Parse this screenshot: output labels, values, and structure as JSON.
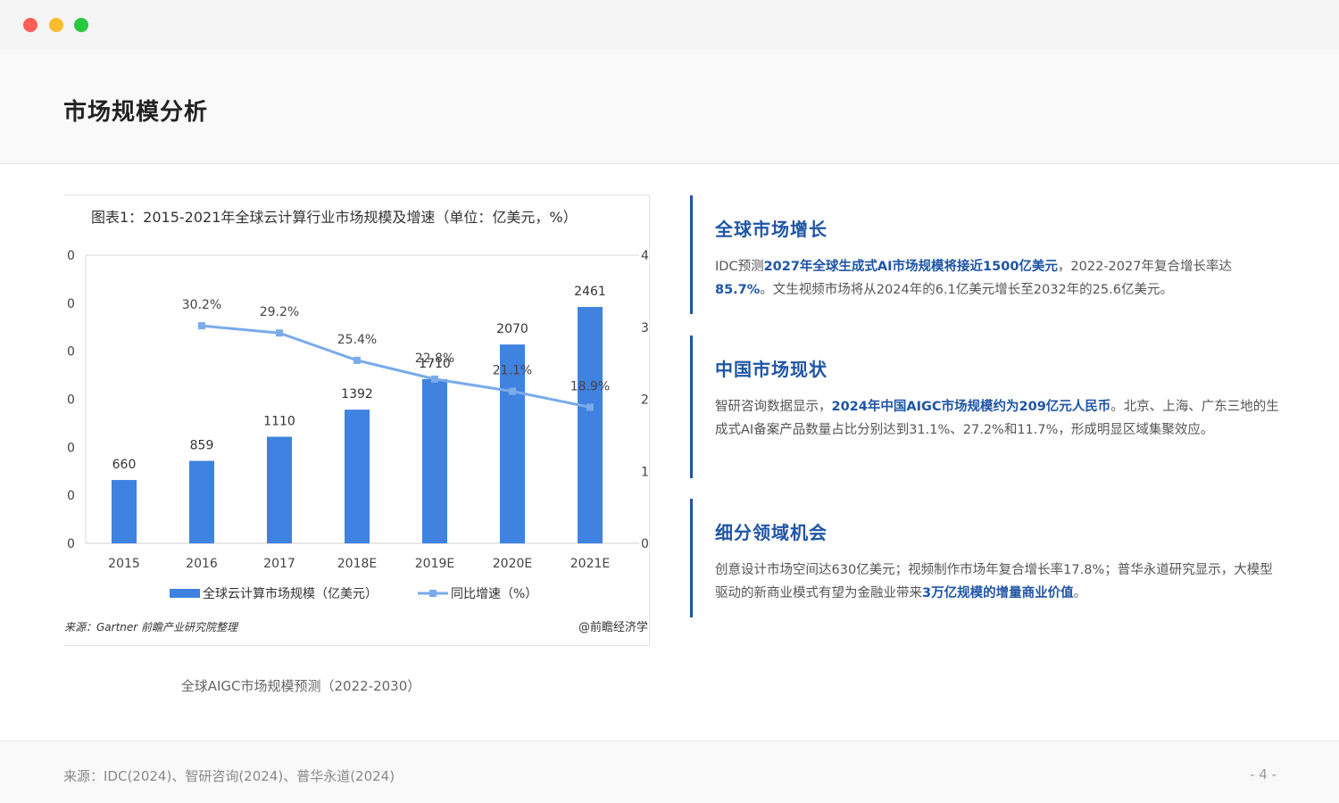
{
  "window": {
    "title": "市场规模分析"
  },
  "chart_data": {
    "type": "bar",
    "title": "图表1：2015-2021年全球云计算行业市场规模及增速（单位：亿美元，%）",
    "categories": [
      "2015",
      "2016",
      "2017",
      "2018E",
      "2019E",
      "2020E",
      "2021E"
    ],
    "series": [
      {
        "name": "全球云计算市场规模（亿美元）",
        "type": "bar",
        "values": [
          660,
          859,
          1110,
          1392,
          1710,
          2070,
          2461
        ],
        "color": "#3f82e0"
      },
      {
        "name": "同比增速（%）",
        "type": "line",
        "values": [
          null,
          30.2,
          29.2,
          25.4,
          22.8,
          21.1,
          18.9
        ],
        "color": "#7aabea"
      }
    ],
    "y_left_tick_labels": [
      "0",
      "0",
      "0",
      "0",
      "0",
      "0",
      "0"
    ],
    "y_right_tick_labels": [
      "0",
      "1",
      "2",
      "3",
      "4"
    ],
    "ylim_left": [
      0,
      3000
    ],
    "ylim_right": [
      0,
      40
    ],
    "grid": false,
    "legend": "bottom",
    "source_left": "来源：Gartner 前瞻产业研究院整理",
    "source_right": "@前瞻经济学"
  },
  "chart_caption": "全球AIGC市场规模预测（2022-2030）",
  "sections": [
    {
      "title": "全球市场增长",
      "parts": [
        {
          "t": "IDC预测"
        },
        {
          "t": "2027年全球生成式AI市场规模将接近1500亿美元",
          "b": true
        },
        {
          "t": "，2022-2027年复合增长率达"
        },
        {
          "t": "85.7%",
          "b": true
        },
        {
          "t": "。文生视频市场将从2024年的6.1亿美元增长至2032年的25.6亿美元。"
        }
      ]
    },
    {
      "title": "中国市场现状",
      "parts": [
        {
          "t": "智研咨询数据显示，"
        },
        {
          "t": "2024年中国AIGC市场规模约为209亿元人民币",
          "b": true
        },
        {
          "t": "。北京、上海、广东三地的生成式AI备案产品数量占比分别达到31.1%、27.2%和11.7%，形成明显区域集聚效应。"
        }
      ]
    },
    {
      "title": "细分领域机会",
      "parts": [
        {
          "t": "创意设计市场空间达630亿美元；视频制作市场年复合增长率17.8%；普华永道研究显示，大模型驱动的新商业模式有望为金融业带来"
        },
        {
          "t": "3万亿规模的增量商业价值",
          "b": true
        },
        {
          "t": "。"
        }
      ]
    }
  ],
  "footer": {
    "source": "来源：IDC(2024)、智研咨询(2024)、普华永道(2024)",
    "page": "- 4 -"
  },
  "colors": {
    "accent": "#1f55a5",
    "bar": "#3f82e0",
    "line": "#7aabea"
  }
}
